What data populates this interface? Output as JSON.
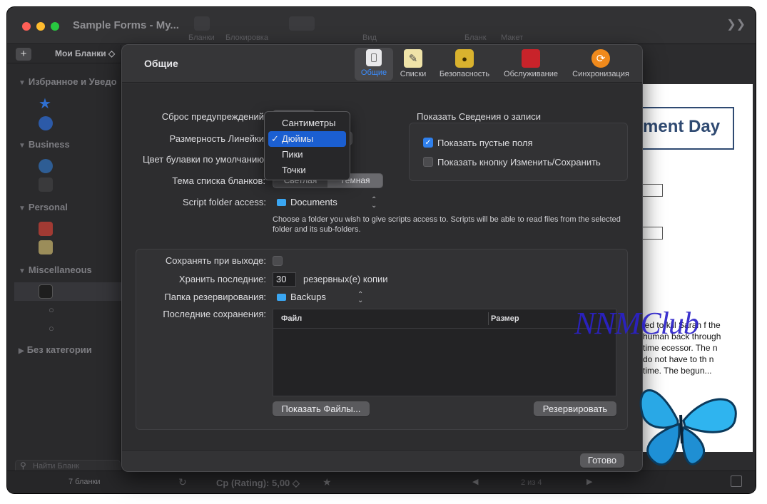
{
  "window": {
    "title": "Sample Forms - My..."
  },
  "toolbar": {
    "items": [
      "Бланки",
      "Блокировка",
      "Вид",
      "Бланк",
      "Макет"
    ]
  },
  "sidebar": {
    "add_label": "+",
    "header": "Мои Бланки ◇",
    "sections": [
      "Избранное и Уведо",
      "Business",
      "Personal",
      "Miscellaneous",
      "Без категории"
    ],
    "search_placeholder": "Найти Бланк",
    "count": "7 бланки"
  },
  "bottombar": {
    "rating": "Ср (Rating): 5,00 ◇",
    "page": "2 из 4"
  },
  "document": {
    "title": "ment Day",
    "text": "ied to kill Sarah f the human back through time ecessor. The n do not have to th     n time. The     begun..."
  },
  "dialog": {
    "title": "Общие",
    "tabs": [
      {
        "label": "Общие",
        "icon": "general-icon"
      },
      {
        "label": "Списки",
        "icon": "lists-icon"
      },
      {
        "label": "Безопасность",
        "icon": "lock-icon"
      },
      {
        "label": "Обслуживание",
        "icon": "toolbox-icon"
      },
      {
        "label": "Синхронизация",
        "icon": "sync-icon"
      }
    ],
    "general": {
      "reset_warnings_label": "Сброс предупреждений",
      "ruler_units_label": "Размерность Линейки",
      "default_pin_color_label": "Цвет булавки по умолчанию",
      "form_list_theme_label": "Тема списка бланков:",
      "theme_options": [
        "Светлая",
        "Тёмная"
      ],
      "theme_selected": "Тёмная",
      "script_folder_label": "Script folder access:",
      "script_folder_value": "Documents",
      "script_folder_note": "Choose a folder you wish to give scripts access to. Scripts will be able to read files from the selected folder and its sub-folders."
    },
    "record_info": {
      "title": "Показать Сведения о записи",
      "show_empty_fields": "Показать пустые поля",
      "show_empty_fields_checked": true,
      "show_edit_save": "Показать кнопку Изменить/Сохранить",
      "show_edit_save_checked": false
    },
    "backup": {
      "save_on_exit_label": "Сохранять при выходе:",
      "keep_last_label": "Хранить последние:",
      "keep_last_value": "30",
      "keep_last_suffix": "резервных(е) копии",
      "backup_folder_label": "Папка резервирования:",
      "backup_folder_value": "Backups",
      "recent_label": "Последние сохранения:",
      "columns": [
        "Файл",
        "Размер"
      ],
      "show_files_button": "Показать Файлы...",
      "backup_button": "Резервировать"
    },
    "done_button": "Готово"
  },
  "ruler_menu": {
    "options": [
      "Сантиметры",
      "Дюймы",
      "Пики",
      "Точки"
    ],
    "selected": "Дюймы",
    "check": "✓"
  },
  "watermark": {
    "text": "NNMClub"
  },
  "colors": {
    "accent": "#2f80ed",
    "menu_highlight": "#1b5fd1",
    "active_tab_label": "#3b8dff"
  }
}
